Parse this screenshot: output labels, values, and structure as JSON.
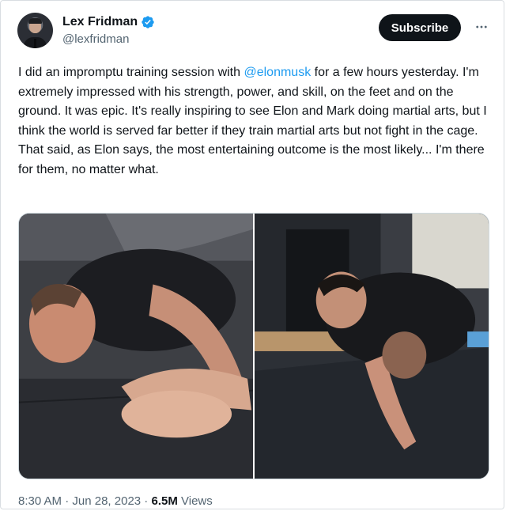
{
  "author": {
    "display_name": "Lex Fridman",
    "handle": "@lexfridman",
    "verified": true,
    "avatar_icon": "profile-photo"
  },
  "actions": {
    "subscribe_label": "Subscribe",
    "more_icon": "more-horizontal-icon"
  },
  "tweet": {
    "text_before_mention": "I did an impromptu training session with ",
    "mention": "@elonmusk",
    "text_after_mention": " for a few hours yesterday. I'm extremely impressed with his strength, power, and skill, on the feet and on the ground. It was epic. It's really inspiring to see Elon and Mark doing martial arts, but I think the world is served far better if they train martial arts but not fight in the cage. That said, as Elon says, the most entertaining outcome is the most likely... I'm there for them, no matter what."
  },
  "media": {
    "photos": [
      {
        "subject": "two men grappling on mat, close view"
      },
      {
        "subject": "two men grappling standing, wide view"
      }
    ]
  },
  "meta": {
    "time": "8:30 AM",
    "separator": " · ",
    "date": "Jun 28, 2023",
    "views_count": "6.5M",
    "views_label": " Views"
  },
  "colors": {
    "link": "#1d9bf0",
    "verified": "#1d9bf0",
    "text_primary": "#0f1419",
    "text_secondary": "#536471"
  }
}
